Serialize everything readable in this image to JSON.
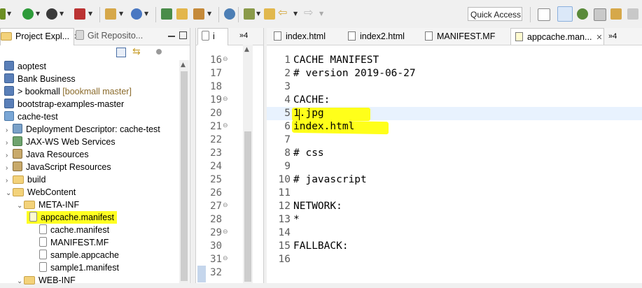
{
  "toolbar": {
    "quick_access": "Quick Access"
  },
  "explorer": {
    "tab_active": "Project Expl...",
    "tab_inactive": "Git Reposito...",
    "items": [
      {
        "label": "aoptest"
      },
      {
        "label": "Bank Business"
      },
      {
        "label": "> bookmall",
        "suffix": "[bookmall master]"
      },
      {
        "label": "bootstrap-examples-master"
      },
      {
        "label": "cache-test"
      },
      {
        "label": "Deployment Descriptor: cache-test"
      },
      {
        "label": "JAX-WS Web Services"
      },
      {
        "label": "Java Resources"
      },
      {
        "label": "JavaScript Resources"
      },
      {
        "label": "build"
      },
      {
        "label": "WebContent"
      },
      {
        "label": "META-INF"
      },
      {
        "label": "appcache.manifest"
      },
      {
        "label": "cache.manifest"
      },
      {
        "label": "MANIFEST.MF"
      },
      {
        "label": "sample.appcache"
      },
      {
        "label": "sample1.manifest"
      },
      {
        "label": "WEB-INF"
      }
    ]
  },
  "mid_editor": {
    "tab_label": "i",
    "overflow": "»4",
    "lines": [
      "16",
      "17",
      "18",
      "19",
      "20",
      "21",
      "22",
      "23",
      "24",
      "25",
      "26",
      "27",
      "28",
      "29",
      "30",
      "31",
      "32"
    ]
  },
  "editor": {
    "tabs": [
      {
        "label": "index.html"
      },
      {
        "label": "index2.html"
      },
      {
        "label": "MANIFEST.MF"
      },
      {
        "label": "appcache.man..."
      }
    ],
    "overflow": "»4",
    "lines": [
      {
        "n": "1",
        "text": "CACHE MANIFEST"
      },
      {
        "n": "2",
        "text": "# version 2019-06-27"
      },
      {
        "n": "3",
        "text": ""
      },
      {
        "n": "4",
        "text": "CACHE:"
      },
      {
        "n": "5",
        "text": "1.jpg"
      },
      {
        "n": "6",
        "text": "index.html"
      },
      {
        "n": "7",
        "text": ""
      },
      {
        "n": "8",
        "text": "# css"
      },
      {
        "n": "9",
        "text": ""
      },
      {
        "n": "10",
        "text": "# javascript"
      },
      {
        "n": "11",
        "text": ""
      },
      {
        "n": "12",
        "text": "NETWORK:"
      },
      {
        "n": "13",
        "text": "*"
      },
      {
        "n": "14",
        "text": ""
      },
      {
        "n": "15",
        "text": "FALLBACK:"
      },
      {
        "n": "16",
        "text": ""
      }
    ]
  }
}
